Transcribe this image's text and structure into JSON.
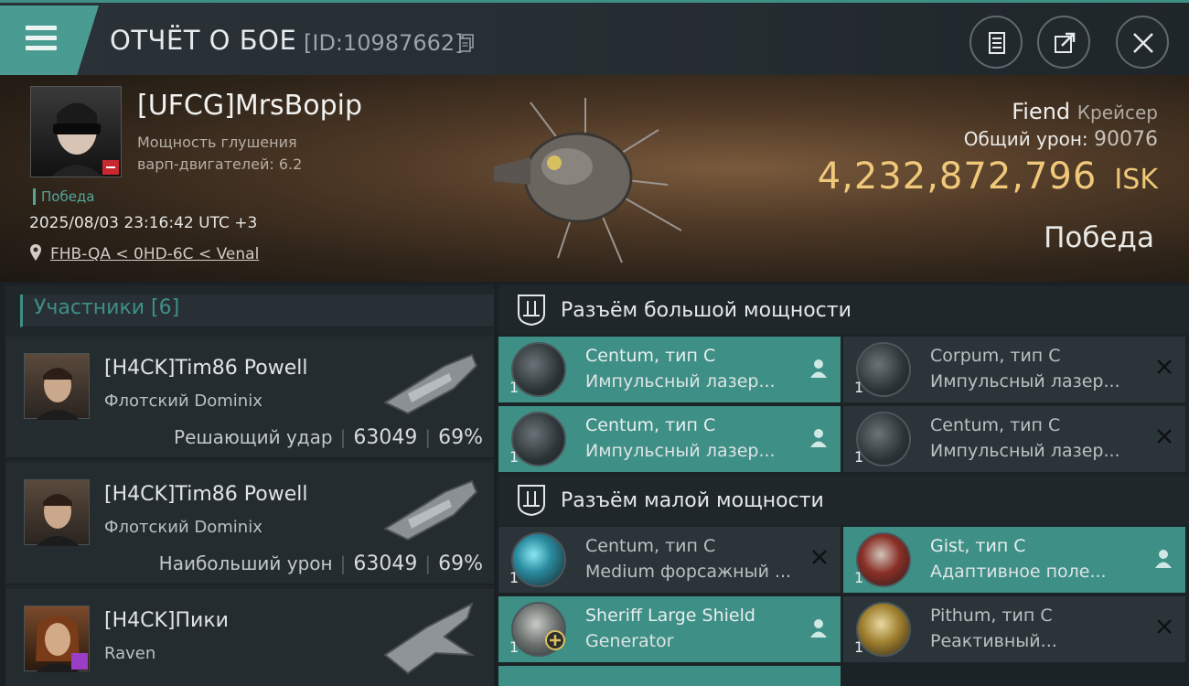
{
  "header": {
    "title": "ОТЧЁТ О БОЕ",
    "report_id": "[ID:10987662]"
  },
  "victim": {
    "pilot": "[UFCG]MrsBopip",
    "stat_line1": "Мощность глушения",
    "stat_line2": "варп-двигателей: 6.2",
    "result_tag": "Победа",
    "datetime": "2025/08/03 23:16:42 UTC +3",
    "location": "FHB-QA < 0HD-6C < Venal",
    "ship_name": "Fiend",
    "ship_class": "Крейсер",
    "damage_label": "Общий урон:",
    "damage_value": "90076",
    "isk_value": "4,232,872,796",
    "isk_unit": "ISK",
    "outcome": "Победа"
  },
  "participants": {
    "header": "Участники [6]",
    "items": [
      {
        "name": "[H4CK]Tim86 Powell",
        "ship": "Флотский Dominix",
        "role": "Решающий удар",
        "damage": "63049",
        "percent": "69%"
      },
      {
        "name": "[H4CK]Tim86 Powell",
        "ship": "Флотский Dominix",
        "role": "Наибольший урон",
        "damage": "63049",
        "percent": "69%"
      },
      {
        "name": "[H4CK]Пики",
        "ship": "Raven",
        "role": "",
        "damage": "",
        "percent": ""
      }
    ]
  },
  "modules": {
    "high_header": "Разъём большой мощности",
    "low_header": "Разъём малой мощности",
    "high": [
      {
        "qty": "1",
        "name": "Centum, тип C",
        "type": "Импульсный лазер...",
        "state": "active"
      },
      {
        "qty": "1",
        "name": "Corpum, тип C",
        "type": "Импульсный лазер...",
        "state": "destroyed"
      },
      {
        "qty": "1",
        "name": "Centum, тип C",
        "type": "Импульсный лазер...",
        "state": "active"
      },
      {
        "qty": "1",
        "name": "Centum, тип C",
        "type": "Импульсный лазер...",
        "state": "destroyed"
      }
    ],
    "low": [
      {
        "qty": "1",
        "name": "Centum, тип C",
        "type": "Medium форсажный ...",
        "state": "destroyed"
      },
      {
        "qty": "1",
        "name": "Gist, тип C",
        "type": "Адаптивное поле...",
        "state": "active"
      },
      {
        "qty": "1",
        "name": "Sheriff Large Shield",
        "type": "Generator",
        "state": "active"
      },
      {
        "qty": "1",
        "name": "Pithum, тип C",
        "type": "Реактивный...",
        "state": "destroyed"
      }
    ]
  },
  "colors": {
    "accent": "#3e8f86",
    "isk": "#f0c87a",
    "badge_red": "#c8282e"
  }
}
